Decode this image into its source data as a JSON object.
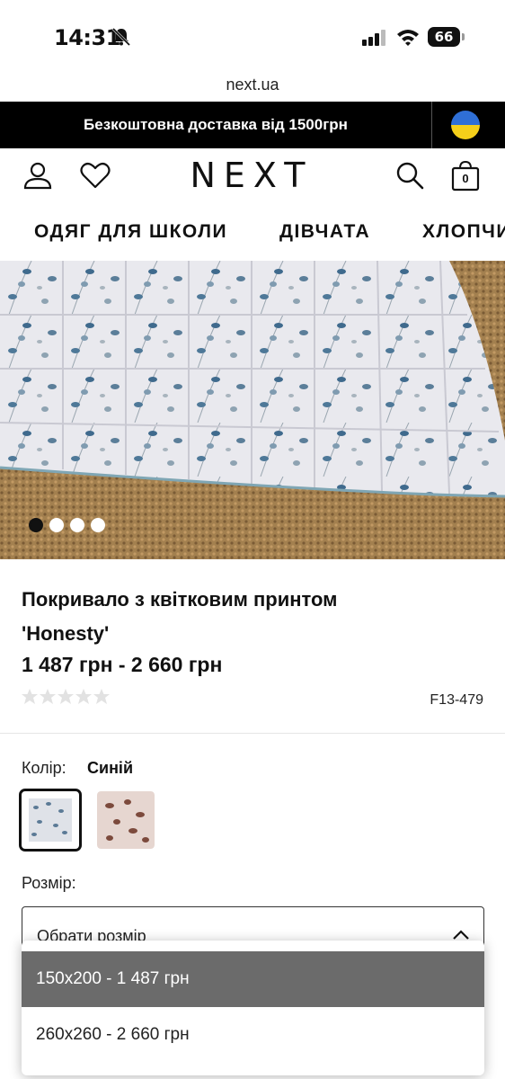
{
  "status_bar": {
    "time": "14:31",
    "battery": "66"
  },
  "browser": {
    "url": "next.ua"
  },
  "promo": {
    "text": "Безкоштовна доставка від 1500грн"
  },
  "header": {
    "logo": "NEXT",
    "bag_count": "0"
  },
  "categories": [
    "ОДЯГ ДЛЯ ШКОЛИ",
    "ДІВЧАТА",
    "ХЛОПЧИ"
  ],
  "carousel": {
    "total_images": 4,
    "active_index": 0
  },
  "product": {
    "title_line1": "Покривало з квітковим принтом",
    "title_line2": "'Honesty'",
    "price": "1 487 грн - 2 660 грн",
    "rating_stars_filled": 0,
    "rating_stars_total": 5,
    "code": "F13-479"
  },
  "color": {
    "label": "Колір:",
    "value": "Синій"
  },
  "size": {
    "label": "Розмір:",
    "select_placeholder": "Обрати розмір",
    "options": [
      {
        "label": "150x200 - 1 487 грн",
        "highlighted": true
      },
      {
        "label": "260x260 - 2 660 грн",
        "highlighted": false
      }
    ]
  },
  "colors": {
    "promo_bg": "#000000",
    "highlight_bg": "#6b6b6b",
    "flag_blue": "#2f6fd6",
    "flag_yellow": "#f5cf1a"
  }
}
